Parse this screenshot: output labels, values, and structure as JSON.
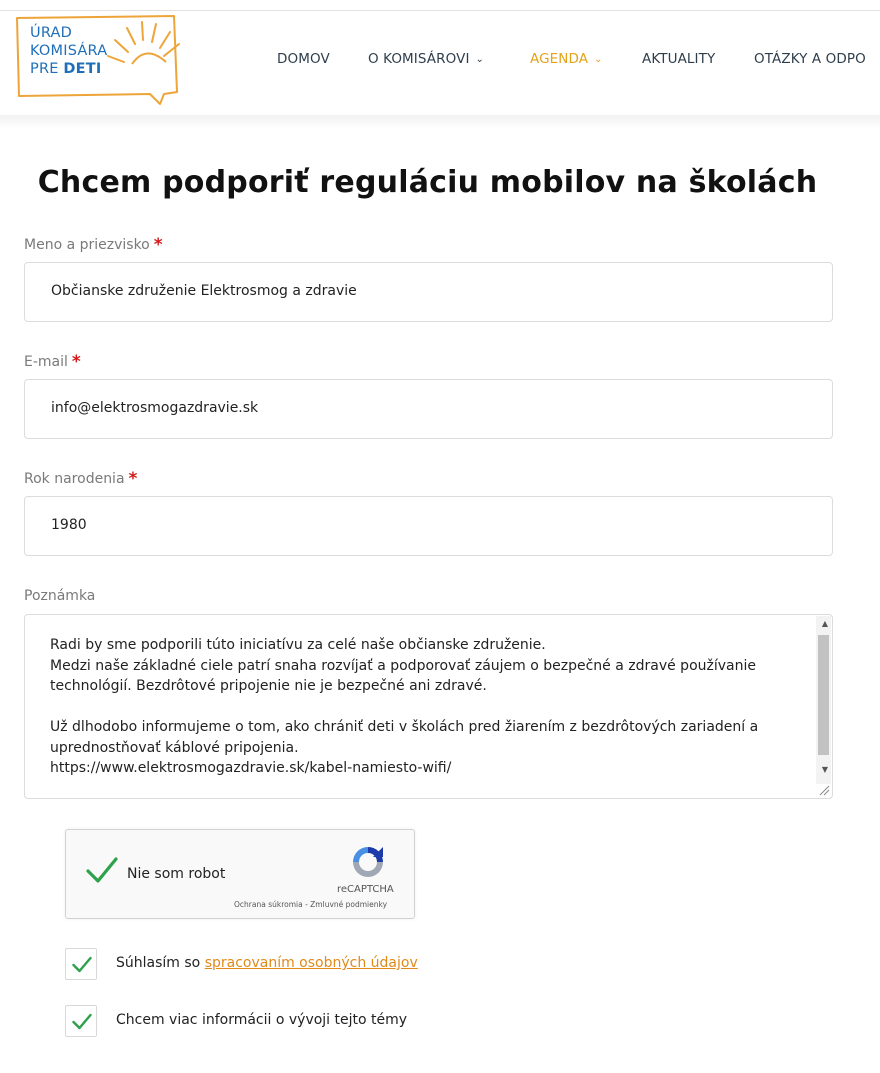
{
  "logo": {
    "line1": "ÚRAD",
    "line2": "KOMISÁRA",
    "line3_prefix": "PRE ",
    "line3_bold": "DETI"
  },
  "nav": {
    "items": [
      {
        "label": "DOMOV",
        "has_dropdown": false,
        "active": false
      },
      {
        "label": "O KOMISÁROVI",
        "has_dropdown": true,
        "active": false
      },
      {
        "label": "AGENDA",
        "has_dropdown": true,
        "active": true
      },
      {
        "label": "AKTUALITY",
        "has_dropdown": false,
        "active": false
      },
      {
        "label": "OTÁZKY A ODPO",
        "has_dropdown": false,
        "active": false
      }
    ],
    "active_color": "#e3a21a",
    "text_color": "#2f3e4c"
  },
  "form": {
    "title": "Chcem podporiť reguláciu mobilov na školách",
    "name": {
      "label": "Meno a priezvisko",
      "required_mark": "*",
      "value": "Občianske združenie Elektrosmog a zdravie"
    },
    "email": {
      "label": "E-mail",
      "required_mark": "*",
      "value": "info@elektrosmogazdravie.sk"
    },
    "birth_year": {
      "label": "Rok narodenia",
      "required_mark": "*",
      "value": "1980"
    },
    "note": {
      "label": "Poznámka",
      "value": "Radi by sme podporili túto iniciatívu za celé naše občianske združenie.\nMedzi naše základné ciele patrí snaha rozvíjať a podporovať záujem o bezpečné a zdravé používanie technológií. Bezdrôtové pripojenie nie je bezpečné ani zdravé.\n\nUž dlhodobo informujeme o tom, ako chrániť deti v školách pred žiarením z bezdrôtových zariadení a uprednostňovať káblové pripojenia.\nhttps://www.elektrosmogazdravie.sk/kabel-namiesto-wifi/"
    },
    "captcha": {
      "label": "Nie som robot",
      "brand": "reCAPTCHA",
      "links": "Ochrana súkromia - Zmluvné podmienky",
      "checked": true
    },
    "consent": {
      "prefix": "Súhlasím so ",
      "link_text": "spracovaním osobných údajov",
      "checked": true
    },
    "more_info": {
      "label": "Chcem viac informácii o vývoji tejto témy",
      "checked": true
    }
  },
  "colors": {
    "required": "#d21a1a",
    "check_green": "#2ea14b",
    "link_orange": "#e08a1a",
    "logo_blue": "#1f6fb8",
    "logo_orange": "#eda53a"
  }
}
